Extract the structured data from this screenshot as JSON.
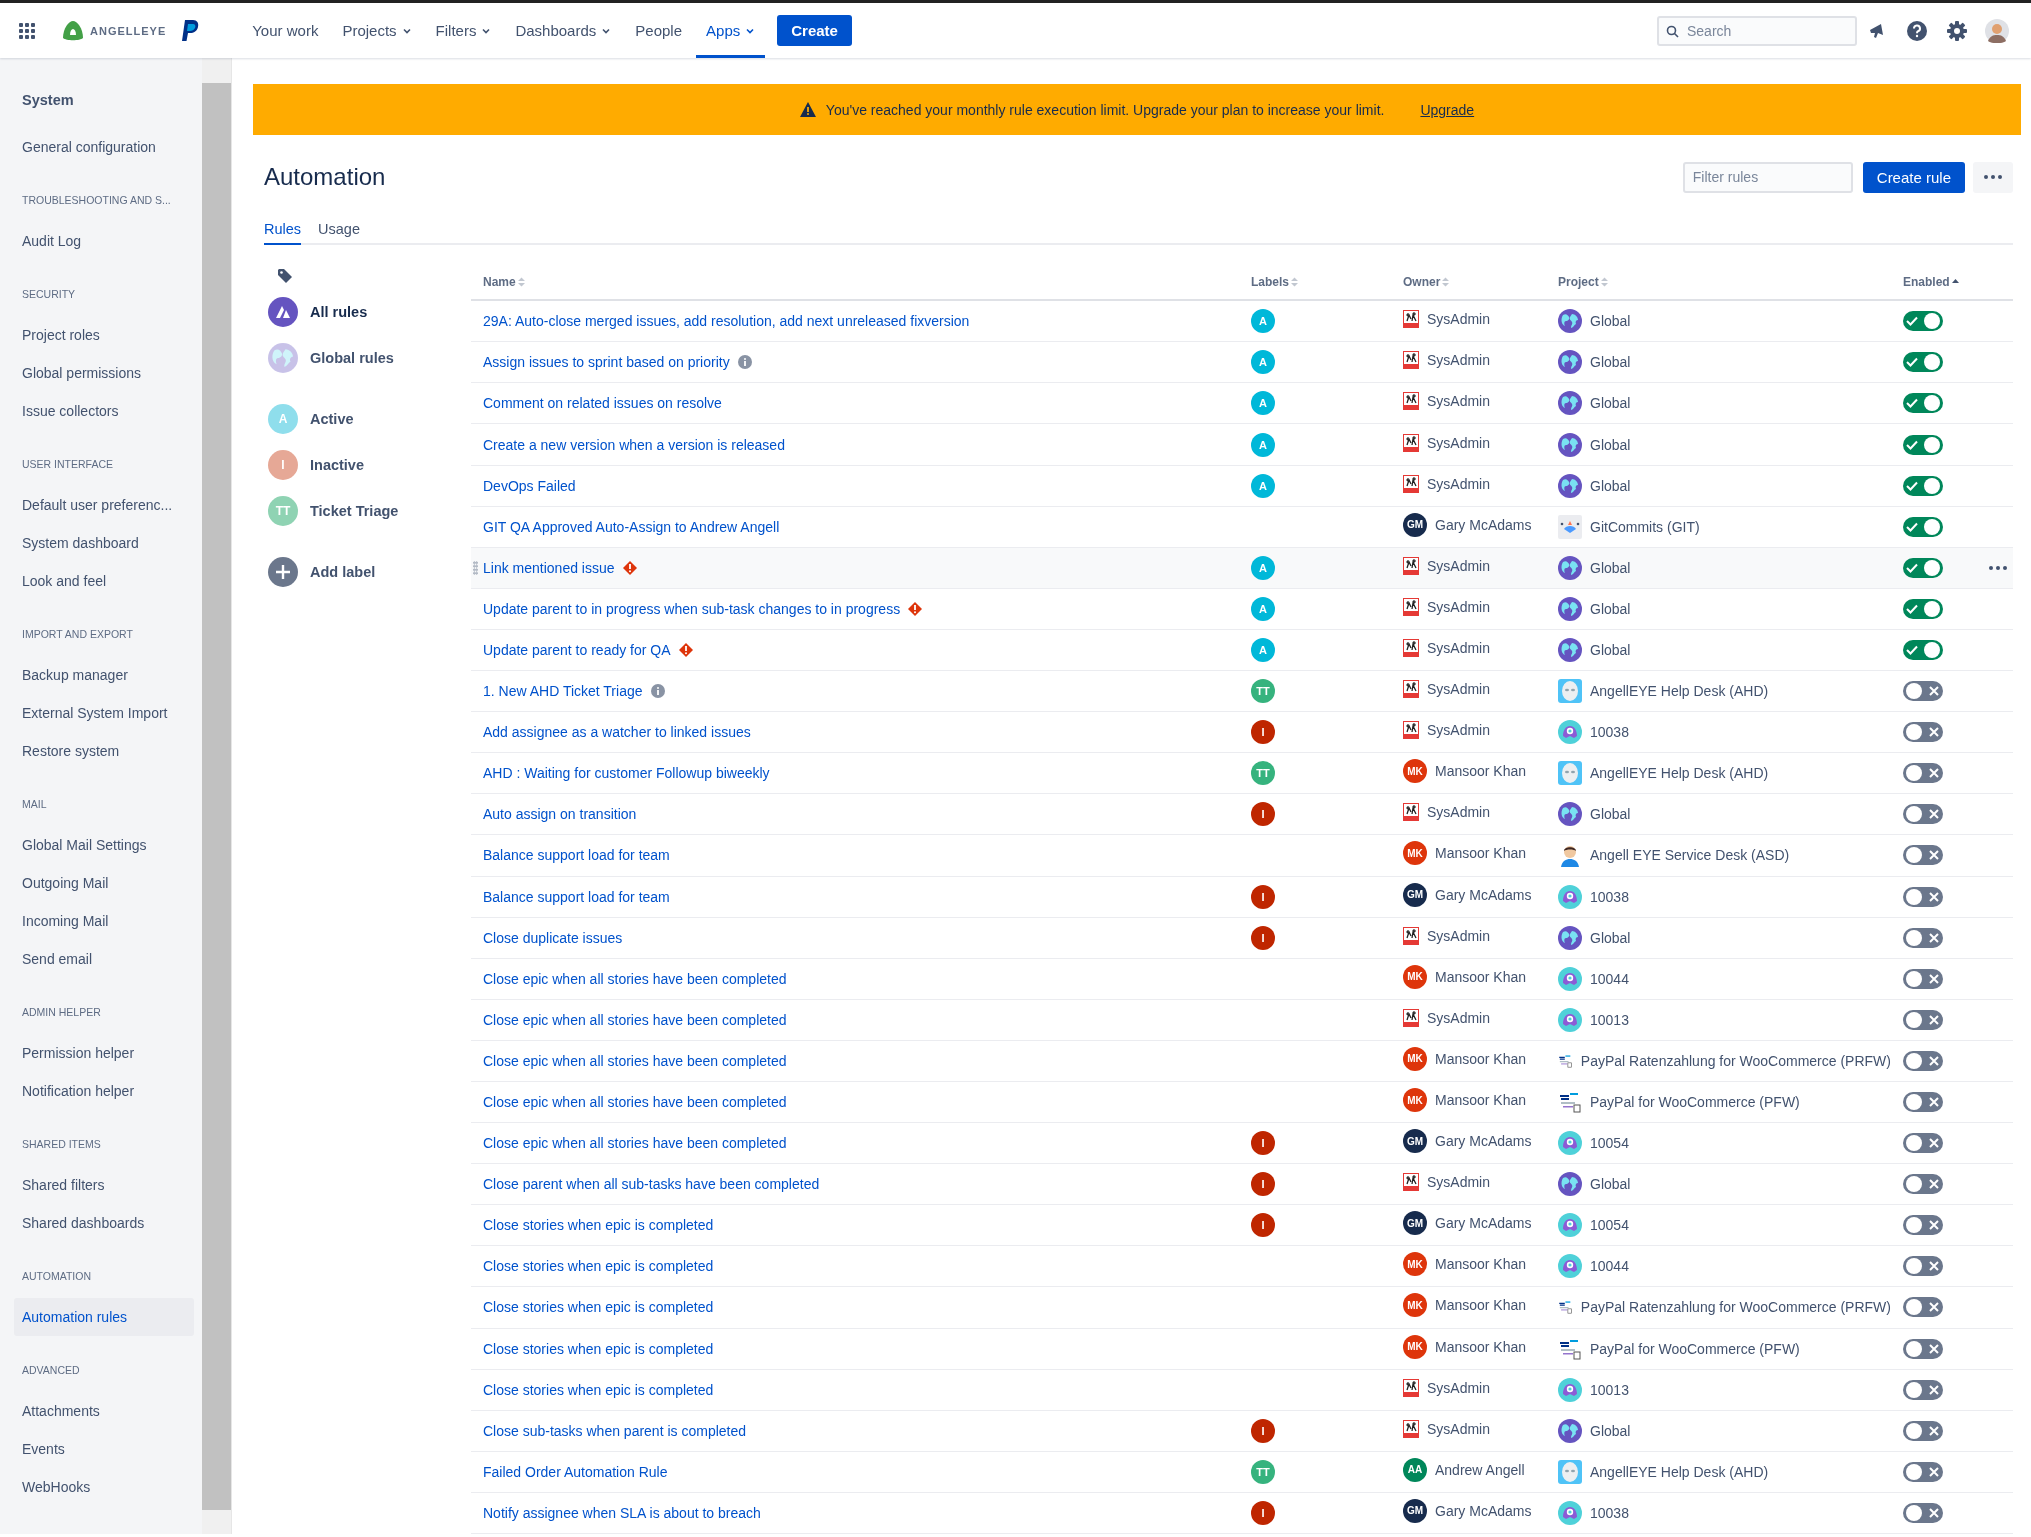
{
  "nav": {
    "logo": "ANGELLEYE",
    "items": [
      {
        "label": "Your work",
        "dropdown": false,
        "selected": false
      },
      {
        "label": "Projects",
        "dropdown": true,
        "selected": false
      },
      {
        "label": "Filters",
        "dropdown": true,
        "selected": false
      },
      {
        "label": "Dashboards",
        "dropdown": true,
        "selected": false
      },
      {
        "label": "People",
        "dropdown": false,
        "selected": false
      },
      {
        "label": "Apps",
        "dropdown": true,
        "selected": true
      }
    ],
    "create": "Create",
    "search": {
      "placeholder": "Search"
    }
  },
  "sidebar": {
    "sections": [
      {
        "heading": "System",
        "bold": true,
        "items": [
          {
            "label": "General configuration",
            "selected": false
          }
        ]
      },
      {
        "heading": "TROUBLESHOOTING AND S...",
        "bold": false,
        "items": [
          {
            "label": "Audit Log",
            "selected": false
          }
        ]
      },
      {
        "heading": "SECURITY",
        "bold": false,
        "items": [
          {
            "label": "Project roles",
            "selected": false
          },
          {
            "label": "Global permissions",
            "selected": false
          },
          {
            "label": "Issue collectors",
            "selected": false
          }
        ]
      },
      {
        "heading": "USER INTERFACE",
        "bold": false,
        "items": [
          {
            "label": "Default user preferenc...",
            "selected": false
          },
          {
            "label": "System dashboard",
            "selected": false
          },
          {
            "label": "Look and feel",
            "selected": false
          }
        ]
      },
      {
        "heading": "IMPORT AND EXPORT",
        "bold": false,
        "items": [
          {
            "label": "Backup manager",
            "selected": false
          },
          {
            "label": "External System Import",
            "selected": false
          },
          {
            "label": "Restore system",
            "selected": false
          }
        ]
      },
      {
        "heading": "MAIL",
        "bold": false,
        "items": [
          {
            "label": "Global Mail Settings",
            "selected": false
          },
          {
            "label": "Outgoing Mail",
            "selected": false
          },
          {
            "label": "Incoming Mail",
            "selected": false
          },
          {
            "label": "Send email",
            "selected": false
          }
        ]
      },
      {
        "heading": "ADMIN HELPER",
        "bold": false,
        "items": [
          {
            "label": "Permission helper",
            "selected": false
          },
          {
            "label": "Notification helper",
            "selected": false
          }
        ]
      },
      {
        "heading": "SHARED ITEMS",
        "bold": false,
        "items": [
          {
            "label": "Shared filters",
            "selected": false
          },
          {
            "label": "Shared dashboards",
            "selected": false
          }
        ]
      },
      {
        "heading": "AUTOMATION",
        "bold": false,
        "items": [
          {
            "label": "Automation rules",
            "selected": true
          }
        ]
      },
      {
        "heading": "ADVANCED",
        "bold": false,
        "items": [
          {
            "label": "Attachments",
            "selected": false
          },
          {
            "label": "Events",
            "selected": false
          },
          {
            "label": "WebHooks",
            "selected": false
          }
        ]
      }
    ]
  },
  "banner": {
    "message": "You've reached your monthly rule execution limit. Upgrade your plan to increase your limit.",
    "link": "Upgrade"
  },
  "page": {
    "title": "Automation",
    "filter": {
      "placeholder": "Filter rules"
    },
    "create_rule": "Create rule"
  },
  "tabs": [
    {
      "label": "Rules",
      "selected": true
    },
    {
      "label": "Usage",
      "selected": false
    }
  ],
  "labels_panel": {
    "items": [
      {
        "label": "All rules",
        "kind": "all",
        "selected": true
      },
      {
        "label": "Global rules",
        "kind": "global",
        "selected": false
      },
      {
        "label": "Active",
        "kind": "label",
        "initials": "A",
        "color": "#8fdeec",
        "selected": false
      },
      {
        "label": "Inactive",
        "kind": "label",
        "initials": "I",
        "color": "#e6a896",
        "selected": false
      },
      {
        "label": "Ticket Triage",
        "kind": "label",
        "initials": "TT",
        "color": "#8fd3b3",
        "selected": false
      }
    ],
    "add": "Add label"
  },
  "table": {
    "columns": [
      {
        "label": "Name",
        "sorted": false
      },
      {
        "label": "Labels",
        "sorted": false
      },
      {
        "label": "Owner",
        "sorted": false
      },
      {
        "label": "Project",
        "sorted": false
      },
      {
        "label": "Enabled",
        "sorted": true
      }
    ],
    "rows": [
      {
        "name": "29A: Auto-close merged issues, add resolution, add next unreleased fixversion",
        "label": {
          "text": "A",
          "color": "#00b8d9"
        },
        "owner": {
          "name": "SysAdmin",
          "kind": "admin"
        },
        "project": {
          "name": "Global",
          "kind": "global"
        },
        "enabled": true,
        "hovered": false
      },
      {
        "name": "Assign issues to sprint based on priority",
        "notice": {
          "kind": "info"
        },
        "label": {
          "text": "A",
          "color": "#00b8d9"
        },
        "owner": {
          "name": "SysAdmin",
          "kind": "admin"
        },
        "project": {
          "name": "Global",
          "kind": "global"
        },
        "enabled": true,
        "hovered": false
      },
      {
        "name": "Comment on related issues on resolve",
        "label": {
          "text": "A",
          "color": "#00b8d9"
        },
        "owner": {
          "name": "SysAdmin",
          "kind": "admin"
        },
        "project": {
          "name": "Global",
          "kind": "global"
        },
        "enabled": true,
        "hovered": false
      },
      {
        "name": "Create a new version when a version is released",
        "label": {
          "text": "A",
          "color": "#00b8d9"
        },
        "owner": {
          "name": "SysAdmin",
          "kind": "admin"
        },
        "project": {
          "name": "Global",
          "kind": "global"
        },
        "enabled": true,
        "hovered": false
      },
      {
        "name": "DevOps Failed",
        "label": {
          "text": "A",
          "color": "#00b8d9"
        },
        "owner": {
          "name": "SysAdmin",
          "kind": "admin"
        },
        "project": {
          "name": "Global",
          "kind": "global"
        },
        "enabled": true,
        "hovered": false
      },
      {
        "name": "GIT QA Approved Auto-Assign to Andrew Angell",
        "owner": {
          "name": "Gary McAdams",
          "kind": "initials",
          "initials": "GM",
          "color": "#172b4d"
        },
        "project": {
          "name": "GitCommits (GIT)",
          "kind": "git"
        },
        "enabled": true,
        "hovered": false
      },
      {
        "name": "Link mentioned issue",
        "notice": {
          "kind": "error"
        },
        "label": {
          "text": "A",
          "color": "#00b8d9"
        },
        "owner": {
          "name": "SysAdmin",
          "kind": "admin"
        },
        "project": {
          "name": "Global",
          "kind": "global"
        },
        "enabled": true,
        "hovered": true
      },
      {
        "name": "Update parent to in progress when sub-task changes to in progress",
        "notice": {
          "kind": "error"
        },
        "label": {
          "text": "A",
          "color": "#00b8d9"
        },
        "owner": {
          "name": "SysAdmin",
          "kind": "admin"
        },
        "project": {
          "name": "Global",
          "kind": "global"
        },
        "enabled": true,
        "hovered": false
      },
      {
        "name": "Update parent to ready for QA",
        "notice": {
          "kind": "error"
        },
        "label": {
          "text": "A",
          "color": "#00b8d9"
        },
        "owner": {
          "name": "SysAdmin",
          "kind": "admin"
        },
        "project": {
          "name": "Global",
          "kind": "global"
        },
        "enabled": true,
        "hovered": false
      },
      {
        "name": "1. New AHD Ticket Triage",
        "notice": {
          "kind": "info"
        },
        "label": {
          "text": "TT",
          "color": "#36b37e"
        },
        "owner": {
          "name": "SysAdmin",
          "kind": "admin"
        },
        "project": {
          "name": "AngellEYE Help Desk (AHD)",
          "kind": "robot"
        },
        "enabled": false,
        "hovered": false
      },
      {
        "name": "Add assignee as a watcher to linked issues",
        "label": {
          "text": "I",
          "color": "#bf2600"
        },
        "owner": {
          "name": "SysAdmin",
          "kind": "admin"
        },
        "project": {
          "name": "10038",
          "kind": "alien"
        },
        "enabled": false,
        "hovered": false
      },
      {
        "name": "AHD : Waiting for customer Followup biweekly",
        "label": {
          "text": "TT",
          "color": "#36b37e"
        },
        "owner": {
          "name": "Mansoor Khan",
          "kind": "initials",
          "initials": "MK",
          "color": "#de350b"
        },
        "project": {
          "name": "AngellEYE Help Desk (AHD)",
          "kind": "robot"
        },
        "enabled": false,
        "hovered": false
      },
      {
        "name": "Auto assign on transition",
        "label": {
          "text": "I",
          "color": "#bf2600"
        },
        "owner": {
          "name": "SysAdmin",
          "kind": "admin"
        },
        "project": {
          "name": "Global",
          "kind": "global"
        },
        "enabled": false,
        "hovered": false
      },
      {
        "name": "Balance support load for team",
        "owner": {
          "name": "Mansoor Khan",
          "kind": "initials",
          "initials": "MK",
          "color": "#de350b"
        },
        "project": {
          "name": "Angell EYE Service Desk (ASD)",
          "kind": "person"
        },
        "enabled": false,
        "hovered": false
      },
      {
        "name": "Balance support load for team",
        "label": {
          "text": "I",
          "color": "#bf2600"
        },
        "owner": {
          "name": "Gary McAdams",
          "kind": "initials",
          "initials": "GM",
          "color": "#172b4d"
        },
        "project": {
          "name": "10038",
          "kind": "alien"
        },
        "enabled": false,
        "hovered": false
      },
      {
        "name": "Close duplicate issues",
        "label": {
          "text": "I",
          "color": "#bf2600"
        },
        "owner": {
          "name": "SysAdmin",
          "kind": "admin"
        },
        "project": {
          "name": "Global",
          "kind": "global"
        },
        "enabled": false,
        "hovered": false
      },
      {
        "name": "Close epic when all stories have been completed",
        "owner": {
          "name": "Mansoor Khan",
          "kind": "initials",
          "initials": "MK",
          "color": "#de350b"
        },
        "project": {
          "name": "10044",
          "kind": "alien"
        },
        "enabled": false,
        "hovered": false
      },
      {
        "name": "Close epic when all stories have been completed",
        "owner": {
          "name": "SysAdmin",
          "kind": "admin"
        },
        "project": {
          "name": "10013",
          "kind": "alien"
        },
        "enabled": false,
        "hovered": false
      },
      {
        "name": "Close epic when all stories have been completed",
        "owner": {
          "name": "Mansoor Khan",
          "kind": "initials",
          "initials": "MK",
          "color": "#de350b"
        },
        "project": {
          "name": "PayPal Ratenzahlung for WooCommerce (PRFW)",
          "kind": "paypal"
        },
        "enabled": false,
        "hovered": false
      },
      {
        "name": "Close epic when all stories have been completed",
        "owner": {
          "name": "Mansoor Khan",
          "kind": "initials",
          "initials": "MK",
          "color": "#de350b"
        },
        "project": {
          "name": "PayPal for WooCommerce (PFW)",
          "kind": "paypal"
        },
        "enabled": false,
        "hovered": false
      },
      {
        "name": "Close epic when all stories have been completed",
        "label": {
          "text": "I",
          "color": "#bf2600"
        },
        "owner": {
          "name": "Gary McAdams",
          "kind": "initials",
          "initials": "GM",
          "color": "#172b4d"
        },
        "project": {
          "name": "10054",
          "kind": "alien"
        },
        "enabled": false,
        "hovered": false
      },
      {
        "name": "Close parent when all sub-tasks have been completed",
        "label": {
          "text": "I",
          "color": "#bf2600"
        },
        "owner": {
          "name": "SysAdmin",
          "kind": "admin"
        },
        "project": {
          "name": "Global",
          "kind": "global"
        },
        "enabled": false,
        "hovered": false
      },
      {
        "name": "Close stories when epic is completed",
        "label": {
          "text": "I",
          "color": "#bf2600"
        },
        "owner": {
          "name": "Gary McAdams",
          "kind": "initials",
          "initials": "GM",
          "color": "#172b4d"
        },
        "project": {
          "name": "10054",
          "kind": "alien"
        },
        "enabled": false,
        "hovered": false
      },
      {
        "name": "Close stories when epic is completed",
        "owner": {
          "name": "Mansoor Khan",
          "kind": "initials",
          "initials": "MK",
          "color": "#de350b"
        },
        "project": {
          "name": "10044",
          "kind": "alien"
        },
        "enabled": false,
        "hovered": false
      },
      {
        "name": "Close stories when epic is completed",
        "owner": {
          "name": "Mansoor Khan",
          "kind": "initials",
          "initials": "MK",
          "color": "#de350b"
        },
        "project": {
          "name": "PayPal Ratenzahlung for WooCommerce (PRFW)",
          "kind": "paypal"
        },
        "enabled": false,
        "hovered": false
      },
      {
        "name": "Close stories when epic is completed",
        "owner": {
          "name": "Mansoor Khan",
          "kind": "initials",
          "initials": "MK",
          "color": "#de350b"
        },
        "project": {
          "name": "PayPal for WooCommerce (PFW)",
          "kind": "paypal"
        },
        "enabled": false,
        "hovered": false
      },
      {
        "name": "Close stories when epic is completed",
        "owner": {
          "name": "SysAdmin",
          "kind": "admin"
        },
        "project": {
          "name": "10013",
          "kind": "alien"
        },
        "enabled": false,
        "hovered": false
      },
      {
        "name": "Close sub-tasks when parent is completed",
        "label": {
          "text": "I",
          "color": "#bf2600"
        },
        "owner": {
          "name": "SysAdmin",
          "kind": "admin"
        },
        "project": {
          "name": "Global",
          "kind": "global"
        },
        "enabled": false,
        "hovered": false
      },
      {
        "name": "Failed Order Automation Rule",
        "label": {
          "text": "TT",
          "color": "#36b37e"
        },
        "owner": {
          "name": "Andrew Angell",
          "kind": "initials",
          "initials": "AA",
          "color": "#00875a"
        },
        "project": {
          "name": "AngellEYE Help Desk (AHD)",
          "kind": "robot"
        },
        "enabled": false,
        "hovered": false
      },
      {
        "name": "Notify assignee when SLA is about to breach",
        "label": {
          "text": "I",
          "color": "#bf2600"
        },
        "owner": {
          "name": "Gary McAdams",
          "kind": "initials",
          "initials": "GM",
          "color": "#172b4d"
        },
        "project": {
          "name": "10038",
          "kind": "alien"
        },
        "enabled": false,
        "hovered": false
      }
    ]
  }
}
